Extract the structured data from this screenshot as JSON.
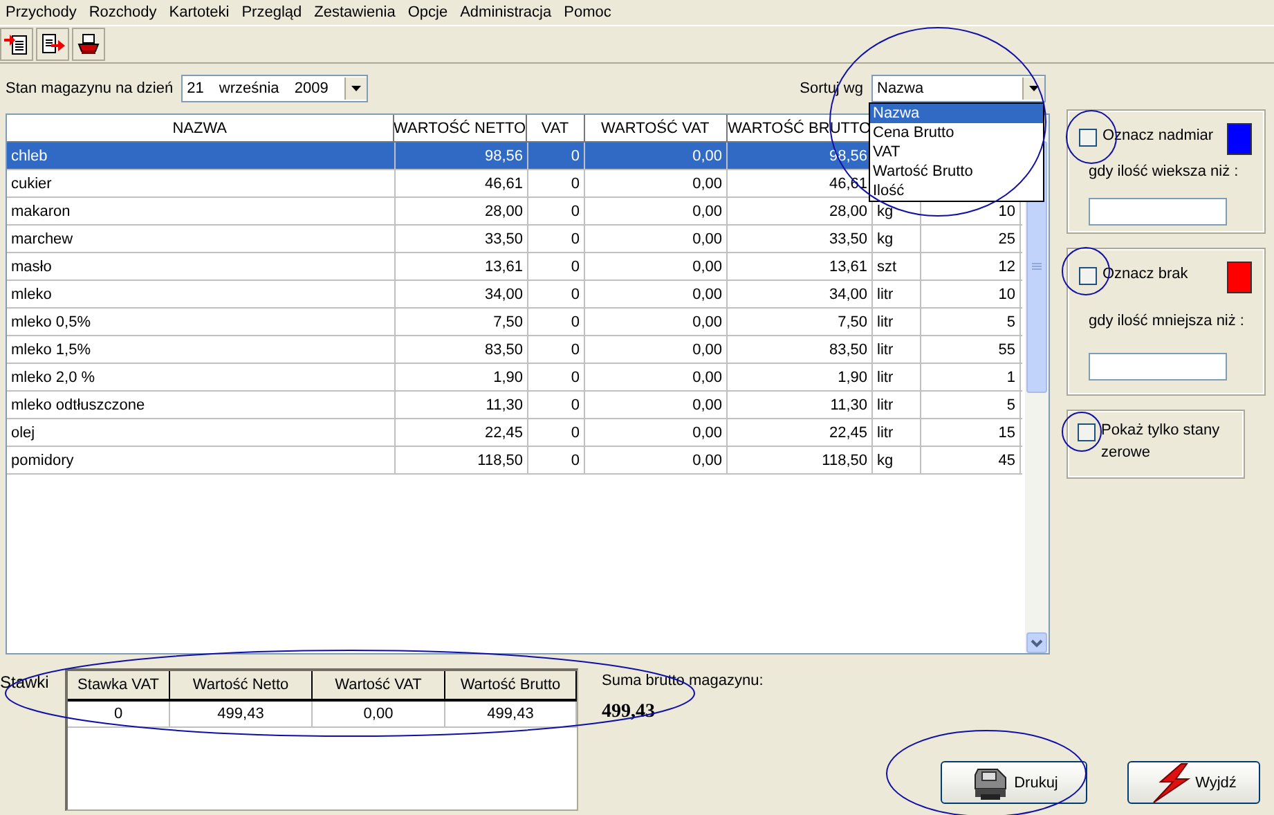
{
  "menu": [
    "Przychody",
    "Rozchody",
    "Kartoteki",
    "Przegląd",
    "Zestawienia",
    "Opcje",
    "Administracja",
    "Pomoc"
  ],
  "toolbar": [
    {
      "kind": "import"
    },
    {
      "kind": "export"
    },
    {
      "kind": "print"
    }
  ],
  "date": {
    "label": "Stan magazynu na dzień",
    "value": "21 września 2009"
  },
  "sort": {
    "label": "Sortuj wg",
    "value": "Nazwa",
    "expanded": true,
    "options": [
      {
        "label": "Nazwa",
        "selected": true
      },
      {
        "label": "Cena Brutto",
        "selected": false
      },
      {
        "label": "VAT",
        "selected": false
      },
      {
        "label": "Wartość Brutto",
        "selected": false
      },
      {
        "label": "Ilość",
        "selected": false
      }
    ]
  },
  "table": {
    "columns": [
      "NAZWA",
      "WARTOŚĆ NETTO",
      "VAT",
      "WARTOŚĆ VAT",
      "WARTOŚĆ BRUTTO"
    ],
    "rows": [
      {
        "name": "chleb",
        "netto": "98,56",
        "vat": "0",
        "wartosc_vat": "0,00",
        "brutto": "98,56",
        "selected": true
      },
      {
        "name": "cukier",
        "netto": "46,61",
        "vat": "0",
        "wartosc_vat": "0,00",
        "brutto": "46,61",
        "selected": false
      },
      {
        "name": "makaron",
        "netto": "28,00",
        "vat": "0",
        "wartosc_vat": "0,00",
        "brutto": "28,00",
        "unit": "kg",
        "qty": "10",
        "selected": false
      },
      {
        "name": "marchew",
        "netto": "33,50",
        "vat": "0",
        "wartosc_vat": "0,00",
        "brutto": "33,50",
        "unit": "kg",
        "qty": "25",
        "selected": false
      },
      {
        "name": "masło",
        "netto": "13,61",
        "vat": "0",
        "wartosc_vat": "0,00",
        "brutto": "13,61",
        "unit": "szt",
        "qty": "12",
        "selected": false
      },
      {
        "name": "mleko",
        "netto": "34,00",
        "vat": "0",
        "wartosc_vat": "0,00",
        "brutto": "34,00",
        "unit": "litr",
        "qty": "10",
        "selected": false
      },
      {
        "name": "mleko 0,5%",
        "netto": "7,50",
        "vat": "0",
        "wartosc_vat": "0,00",
        "brutto": "7,50",
        "unit": "litr",
        "qty": "5",
        "selected": false
      },
      {
        "name": "mleko 1,5%",
        "netto": "83,50",
        "vat": "0",
        "wartosc_vat": "0,00",
        "brutto": "83,50",
        "unit": "litr",
        "qty": "55",
        "selected": false
      },
      {
        "name": "mleko 2,0 %",
        "netto": "1,90",
        "vat": "0",
        "wartosc_vat": "0,00",
        "brutto": "1,90",
        "unit": "litr",
        "qty": "1",
        "selected": false
      },
      {
        "name": "mleko odtłuszczone",
        "netto": "11,30",
        "vat": "0",
        "wartosc_vat": "0,00",
        "brutto": "11,30",
        "unit": "litr",
        "qty": "5",
        "selected": false
      },
      {
        "name": "olej",
        "netto": "22,45",
        "vat": "0",
        "wartosc_vat": "0,00",
        "brutto": "22,45",
        "unit": "litr",
        "qty": "15",
        "selected": false
      },
      {
        "name": "pomidory",
        "netto": "118,50",
        "vat": "0",
        "wartosc_vat": "0,00",
        "brutto": "118,50",
        "unit": "kg",
        "qty": "45",
        "selected": false
      }
    ]
  },
  "options": [
    {
      "kind": "threshold",
      "label": "Oznacz nadmiar",
      "checked": false,
      "color": "#0000ff",
      "caption": "gdy ilość wieksza niż :"
    },
    {
      "kind": "threshold",
      "label": "Oznacz brak",
      "checked": false,
      "color": "#ff0000",
      "caption": "gdy ilość mniejsza niż :"
    },
    {
      "kind": "toggle",
      "label": "Pokaż tylko stany zerowe",
      "checked": false
    }
  ],
  "rates": {
    "label": "Stawki",
    "columns": [
      "Stawka VAT",
      "Wartość Netto",
      "Wartość VAT",
      "Wartość Brutto"
    ],
    "rows": [
      [
        "0",
        "499,43",
        "0,00",
        "499,43"
      ]
    ]
  },
  "total": {
    "label": "Suma brutto magazynu:",
    "value": "499,43"
  },
  "buttons": [
    {
      "kind": "print",
      "label": "Drukuj"
    },
    {
      "kind": "exit",
      "label": "Wyjdź"
    }
  ]
}
